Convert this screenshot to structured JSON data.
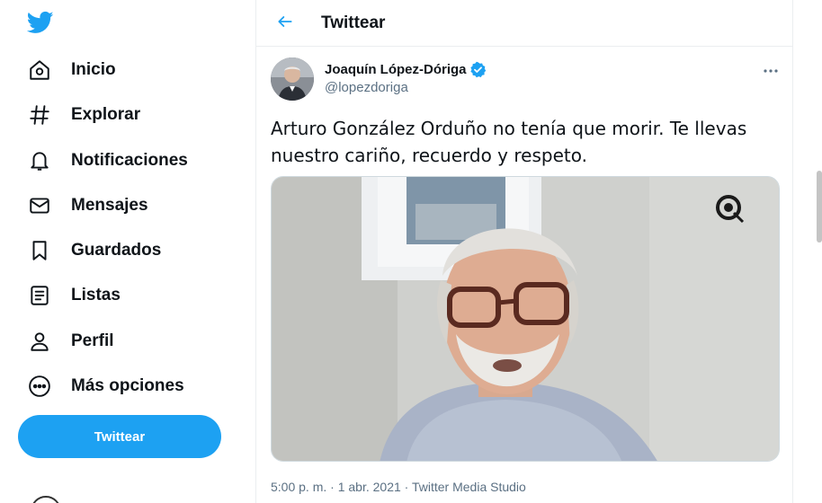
{
  "nav": {
    "items": [
      {
        "label": "Inicio",
        "icon": "home-icon"
      },
      {
        "label": "Explorar",
        "icon": "hashtag-icon"
      },
      {
        "label": "Notificaciones",
        "icon": "bell-icon"
      },
      {
        "label": "Mensajes",
        "icon": "envelope-icon"
      },
      {
        "label": "Guardados",
        "icon": "bookmark-icon"
      },
      {
        "label": "Listas",
        "icon": "list-icon"
      },
      {
        "label": "Perfil",
        "icon": "person-icon"
      },
      {
        "label": "Más opciones",
        "icon": "more-circle-icon"
      }
    ],
    "tweet_button": "Twittear"
  },
  "header": {
    "title": "Twittear"
  },
  "tweet": {
    "author_name": "Joaquín López-Dóriga",
    "author_handle": "@lopezdoriga",
    "text": "Arturo González Orduño no tenía que morir. Te llevas nuestro cariño, recuerdo y respeto.",
    "time": "5:00 p. m.",
    "date": "1 abr. 2021",
    "source": "Twitter Media Studio",
    "separator": "·"
  },
  "colors": {
    "accent": "#1da1f2",
    "text": "#0f1419",
    "secondary": "#5b7083"
  }
}
